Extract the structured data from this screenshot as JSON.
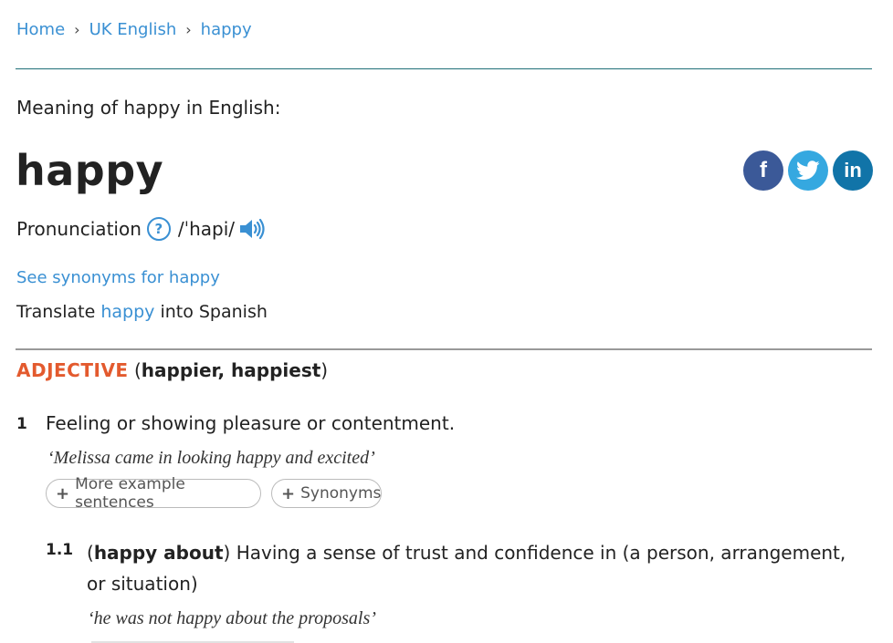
{
  "breadcrumb": {
    "home": "Home",
    "section": "UK English",
    "current": "happy",
    "separator": "›"
  },
  "meaning_intro": "Meaning of happy in English:",
  "headword": "happy",
  "social": {
    "facebook": "f",
    "linkedin": "in",
    "icons": [
      "facebook-icon",
      "twitter-icon",
      "linkedin-icon"
    ],
    "colors": {
      "facebook": "#3b5998",
      "twitter": "#35a8e0",
      "linkedin": "#1174a8"
    }
  },
  "pronunciation": {
    "label": "Pronunciation",
    "help": "?",
    "ipa": "/ˈhapi/"
  },
  "see_synonyms": "See synonyms for happy",
  "translate": {
    "prefix": "Translate",
    "word": "happy",
    "suffix": "into Spanish"
  },
  "entry": {
    "pos": "ADJECTIVE",
    "forms_open": "(",
    "forms": "happier, happiest",
    "forms_close": ")",
    "pos_color": "#e35a2e",
    "senses": [
      {
        "number": "1",
        "definition": "Feeling or showing pleasure or contentment.",
        "example": "‘Melissa came in looking happy and excited’",
        "buttons": {
          "more_examples": "More example sentences",
          "synonyms": "Synonyms",
          "plus": "+"
        }
      }
    ],
    "subsenses": [
      {
        "number": "1.1",
        "open": "(",
        "keyword": "happy about",
        "close": ")",
        "definition": " Having a sense of trust and confidence in (a person, arrangement, or situation)",
        "example": "‘he was not happy about the proposals’"
      }
    ]
  },
  "link_color": "#3a90d3"
}
